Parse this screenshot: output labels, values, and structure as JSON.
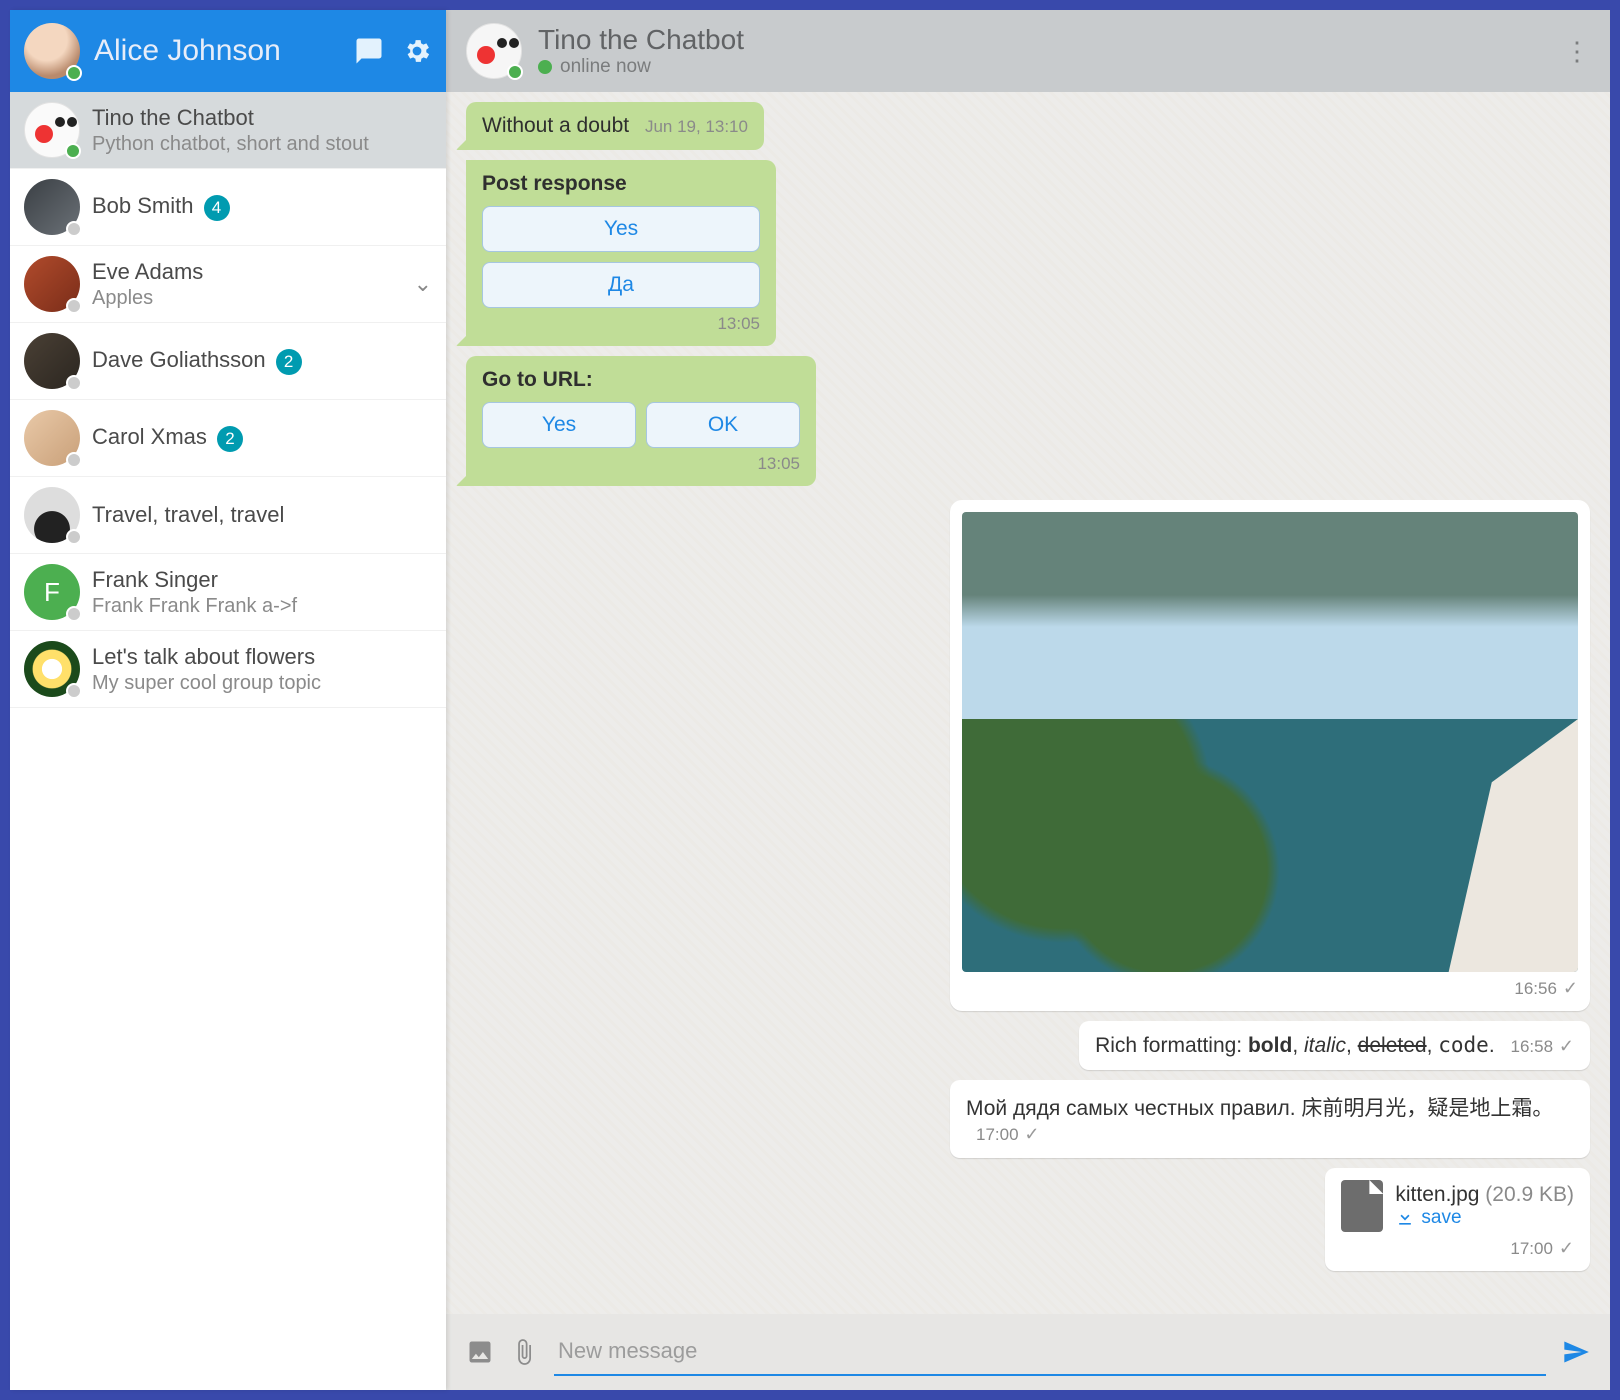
{
  "sidebar": {
    "username": "Alice Johnson",
    "items": [
      {
        "name": "Tino the Chatbot",
        "sub": "Python chatbot, short and stout",
        "selected": true,
        "online": true,
        "avatar": "clown"
      },
      {
        "name": "Bob Smith",
        "badge": "4",
        "avatar": "av-b"
      },
      {
        "name": "Eve Adams",
        "sub": "Apples",
        "chevron": true,
        "avatar": "av-e"
      },
      {
        "name": "Dave Goliathsson",
        "badge": "2",
        "avatar": "av-d"
      },
      {
        "name": "Carol Xmas",
        "badge": "2",
        "avatar": "av-c"
      },
      {
        "name": "Travel, travel, travel",
        "avatar": "av-t"
      },
      {
        "name": "Frank Singer",
        "sub": "Frank Frank Frank a->f",
        "avatar": "av-f",
        "letter": "F"
      },
      {
        "name": "Let's talk about flowers",
        "sub": "My super cool group topic",
        "avatar": "av-fl"
      }
    ]
  },
  "chat": {
    "title": "Tino the Chatbot",
    "status": "online now",
    "messages": {
      "m0": {
        "text": "Without a doubt",
        "ts": "Jun 19, 13:10"
      },
      "m1": {
        "title": "Post response",
        "btn1": "Yes",
        "btn2": "Да",
        "ts": "13:05"
      },
      "m2": {
        "title": "Go to URL:",
        "btn1": "Yes",
        "btn2": "OK",
        "ts": "13:05"
      },
      "m3": {
        "ts": "16:56"
      },
      "m4": {
        "prefix": "Rich formatting: ",
        "bold": "bold",
        "sep1": ", ",
        "italic": "italic",
        "sep2": ", ",
        "del": "deleted",
        "sep3": ", ",
        "code": "code",
        "suffix": ".",
        "ts": "16:58"
      },
      "m5": {
        "text": "Мой дядя самых честных правил. 床前明月光，疑是地上霜。",
        "ts": "17:00"
      },
      "m6": {
        "filename": "kitten.jpg",
        "size": "(20.9 KB)",
        "save": "save",
        "ts": "17:00"
      }
    },
    "composer_placeholder": "New message"
  }
}
